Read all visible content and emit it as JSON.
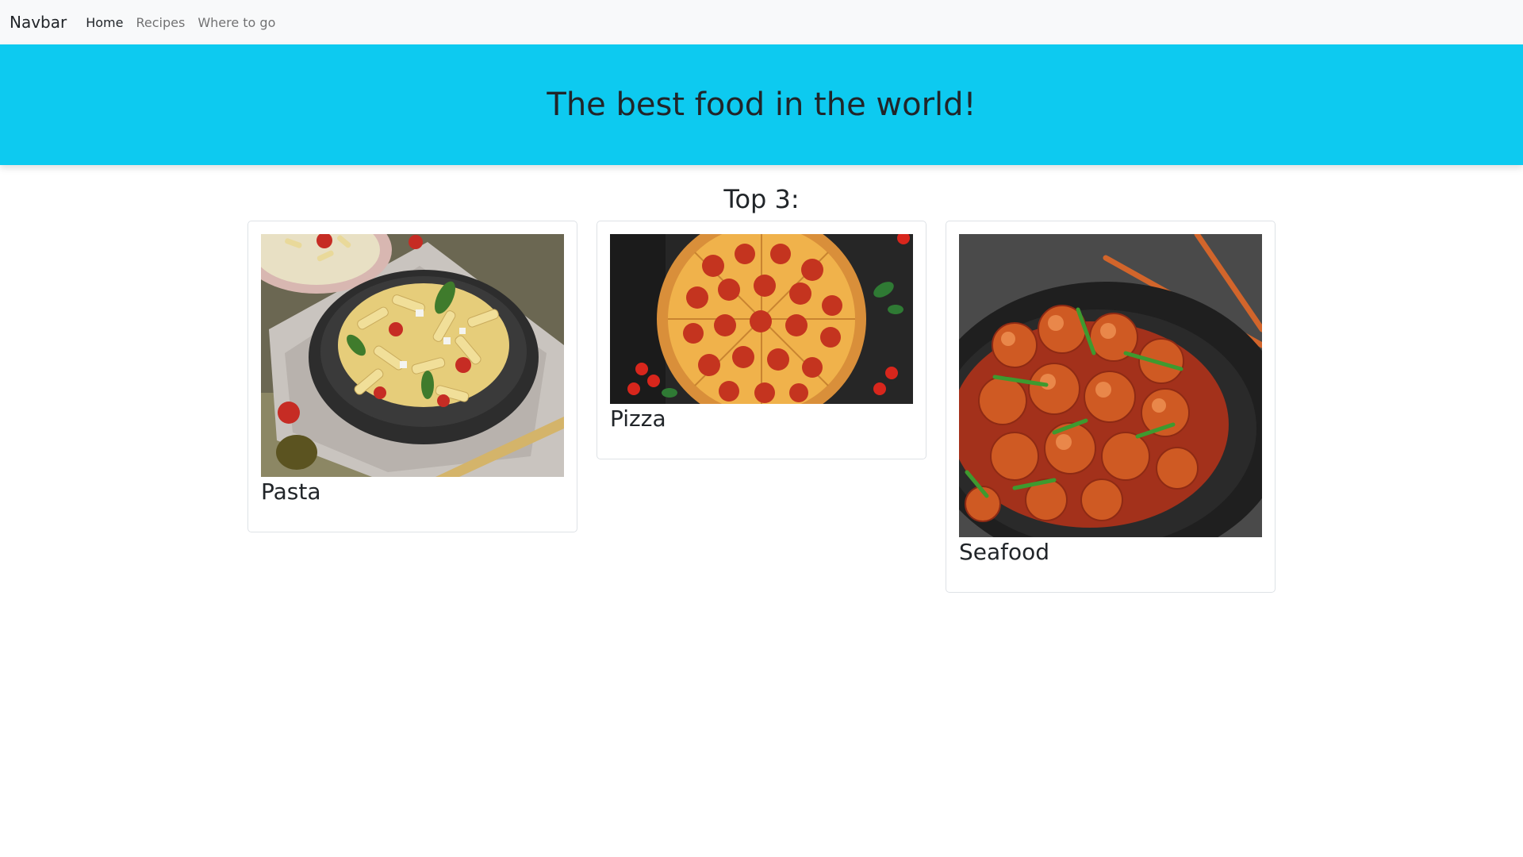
{
  "navbar": {
    "brand": "Navbar",
    "links": [
      {
        "label": "Home",
        "active": true
      },
      {
        "label": "Recipes",
        "active": false
      },
      {
        "label": "Where to go",
        "active": false
      }
    ]
  },
  "hero": {
    "title": "The best food in the world!",
    "bg": "#0dcaf0"
  },
  "section": {
    "title": "Top 3:"
  },
  "cards": [
    {
      "title": "Pasta",
      "image": "pasta-bowl-photo"
    },
    {
      "title": "Pizza",
      "image": "pepperoni-pizza-photo"
    },
    {
      "title": "Seafood",
      "image": "spicy-shrimp-bowl-photo"
    }
  ]
}
